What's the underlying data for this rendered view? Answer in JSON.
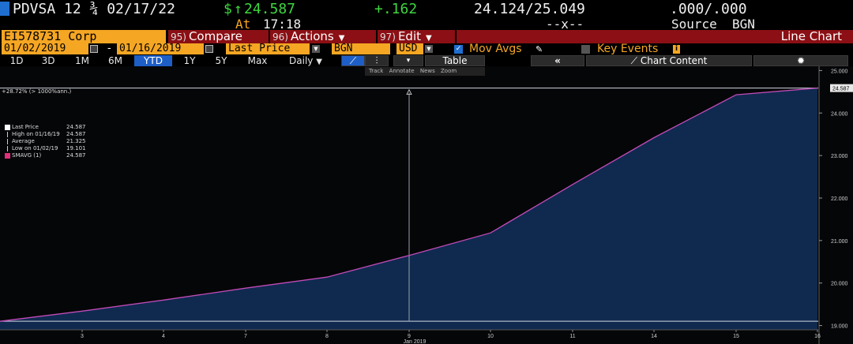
{
  "ticker": {
    "name": "PDVSA 12 ¾ 02/17/22",
    "currency_symbol": "$",
    "arrow": "↑",
    "last": "24.587",
    "change": "+.162",
    "bid_ask": "24.124/25.049",
    "bid_ask_size": ".000/.000",
    "time_label": "At",
    "time": "17:18",
    "placeholder": "--x--",
    "source_label": "Source",
    "source": "BGN"
  },
  "toolbar": {
    "security": "EI578731 Corp",
    "compare_num": "95)",
    "compare": "Compare",
    "actions_num": "96)",
    "actions": "Actions",
    "edit_num": "97)",
    "edit": "Edit",
    "chart_title": "Line Chart"
  },
  "fields": {
    "start_date": "01/02/2019",
    "end_date": "01/16/2019",
    "price_field": "Last Price",
    "source": "BGN",
    "currency": "USD",
    "mov_avgs": "Mov Avgs",
    "key_events": "Key Events",
    "dash": "-"
  },
  "periods": [
    "1D",
    "3D",
    "1M",
    "6M",
    "YTD",
    "1Y",
    "5Y",
    "Max"
  ],
  "active_period": "YTD",
  "frequency": "Daily",
  "table_label": "Table",
  "chart_content_label": "Chart Content",
  "mini_tools": [
    "Track",
    "Annotate",
    "News",
    "Zoom"
  ],
  "pct_label": "+28.72% (> 1000%ann.)",
  "legend": [
    {
      "name": "Last Price",
      "value": "24.587",
      "color": "#ffffff"
    },
    {
      "name": "High on 01/16/19",
      "value": "24.587",
      "color": "#cccccc"
    },
    {
      "name": "Average",
      "value": "21.325",
      "color": "#cccccc"
    },
    {
      "name": "Low on 01/02/19",
      "value": "19.101",
      "color": "#cccccc"
    },
    {
      "name": "SMAVG (1)",
      "value": "24.587",
      "color": "#e0307a"
    }
  ],
  "colors": {
    "amber": "#f5a623",
    "menu_red": "#8b0f14",
    "active_blue": "#1e5fc7",
    "area_fill": "#102a4f",
    "line": "#c24bb7",
    "price_green": "#3ed63e"
  },
  "chart_data": {
    "type": "area",
    "x": [
      "2",
      "3",
      "4",
      "7",
      "8",
      "9",
      "10",
      "11",
      "14",
      "15",
      "16"
    ],
    "x_tick_labels": [
      "3",
      "4",
      "7",
      "8",
      "9",
      "10",
      "11",
      "14",
      "15",
      "16"
    ],
    "xlabel": "Jan 2019",
    "series": [
      {
        "name": "Last Price",
        "values": [
          19.101,
          19.34,
          19.6,
          19.88,
          20.14,
          20.65,
          21.18,
          22.32,
          23.42,
          24.43,
          24.587
        ]
      }
    ],
    "y_ticks": [
      "19.000",
      "20.000",
      "21.000",
      "22.000",
      "23.000",
      "24.000",
      "25.000"
    ],
    "ylim": [
      18.9,
      25.1
    ],
    "last_value_label": "24.587",
    "low_line": 19.101,
    "high_line": 24.587,
    "grid": false
  }
}
